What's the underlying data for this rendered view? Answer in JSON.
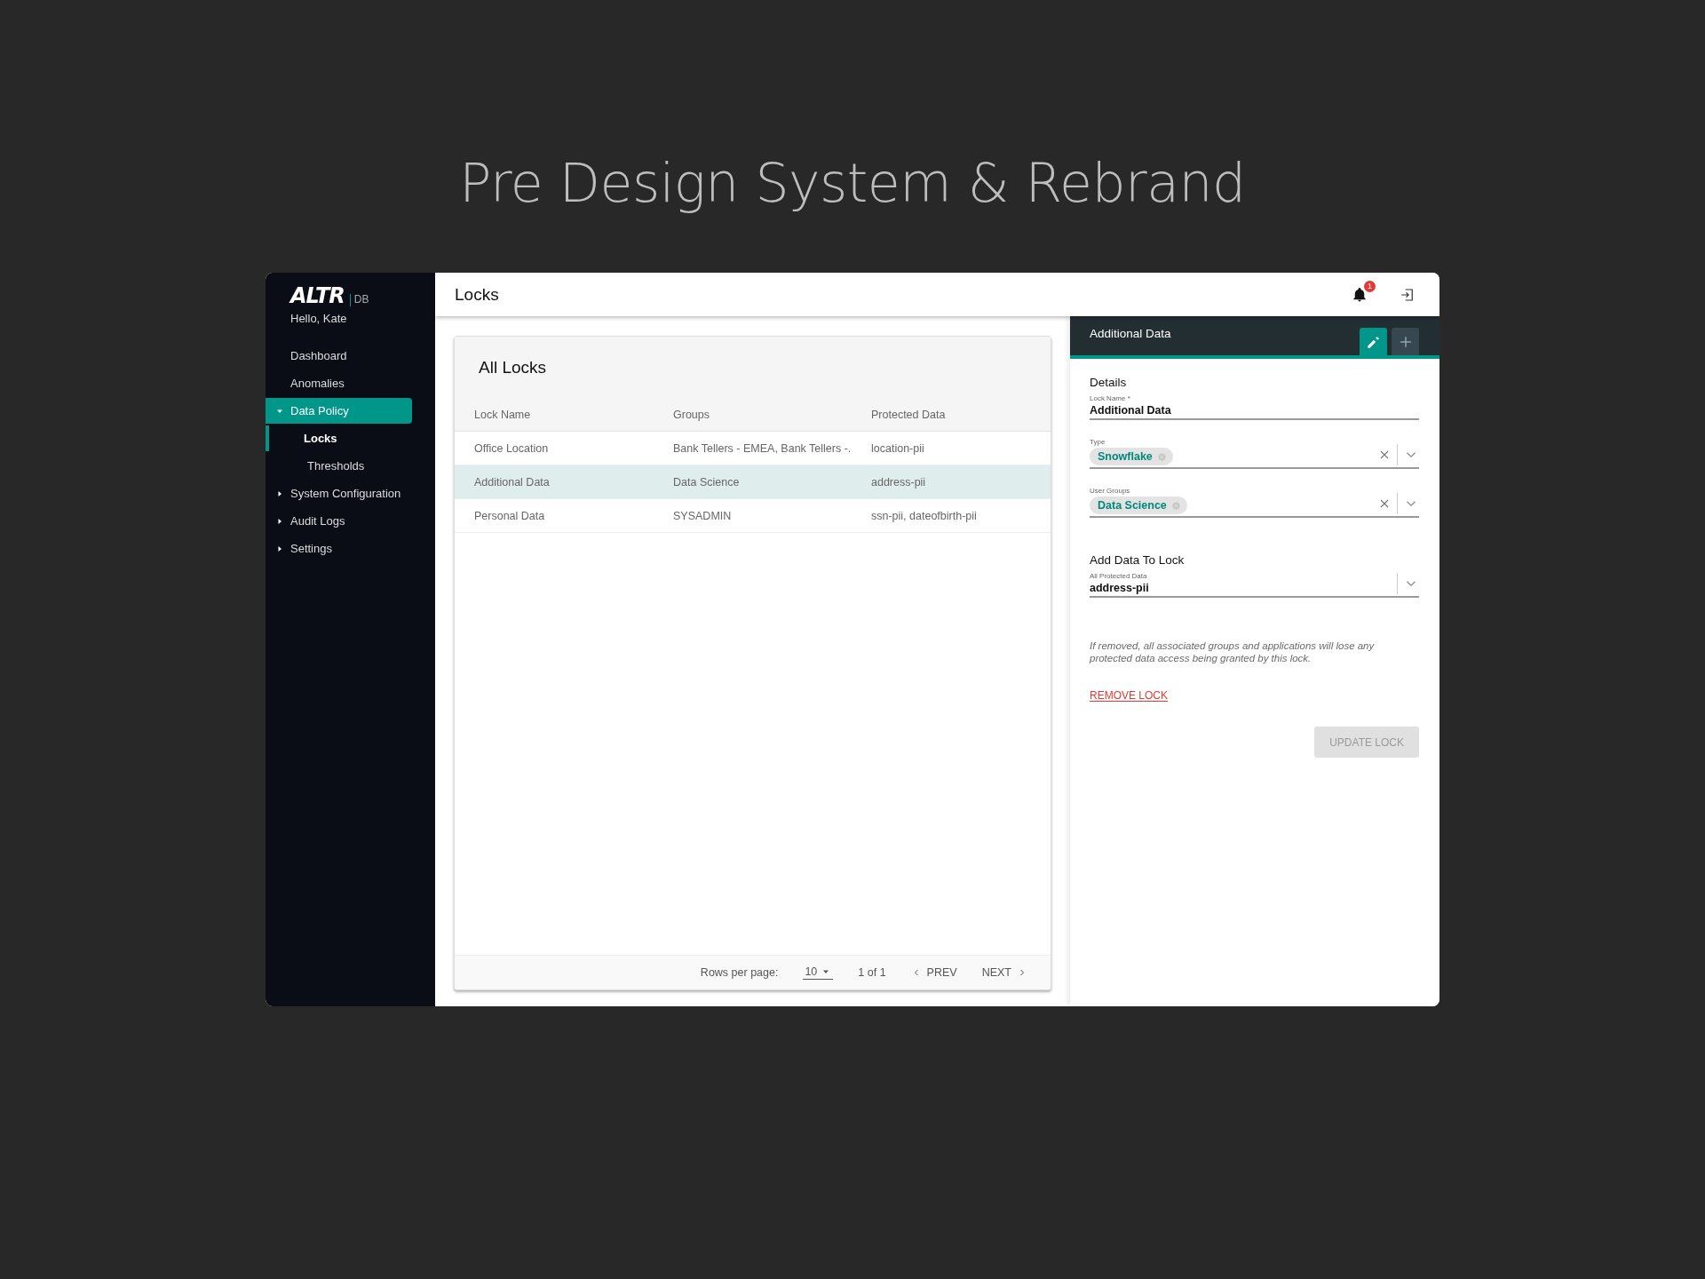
{
  "slide_title": "Pre Design System & Rebrand",
  "sidebar": {
    "logo": "ALTR",
    "logo_suffix": "DB",
    "greeting": "Hello, Kate",
    "items": [
      {
        "label": "Dashboard",
        "kind": "link",
        "selected": false
      },
      {
        "label": "Anomalies",
        "kind": "link",
        "selected": false
      },
      {
        "label": "Data Policy",
        "kind": "group",
        "expanded": true,
        "selected": true,
        "children": [
          {
            "label": "Locks",
            "selected": true
          },
          {
            "label": "Thresholds",
            "selected": false
          }
        ]
      },
      {
        "label": "System Configuration",
        "kind": "group",
        "expanded": false,
        "selected": false
      },
      {
        "label": "Audit Logs",
        "kind": "group",
        "expanded": false,
        "selected": false
      },
      {
        "label": "Settings",
        "kind": "group",
        "expanded": false,
        "selected": false
      }
    ]
  },
  "topbar": {
    "title": "Locks",
    "notification_count": "1"
  },
  "locks_card": {
    "title": "All Locks",
    "columns": [
      "Lock Name",
      "Groups",
      "Protected Data"
    ],
    "rows": [
      {
        "cells": [
          "Office Location",
          "Bank Tellers - EMEA, Bank Tellers -.",
          "location-pii"
        ],
        "selected": false
      },
      {
        "cells": [
          "Additional Data",
          "Data Science",
          "address-pii"
        ],
        "selected": true
      },
      {
        "cells": [
          "Personal Data",
          "SYSADMIN",
          "ssn-pii, dateofbirth-pii"
        ],
        "selected": false
      }
    ],
    "pagination": {
      "rows_per_page_label": "Rows per page:",
      "rows_per_page": "10",
      "page_info": "1 of 1",
      "prev": "PREV",
      "next": "NEXT"
    }
  },
  "detail_panel": {
    "title": "Additional Data",
    "tools": [
      {
        "kind": "edit",
        "selected": true
      },
      {
        "kind": "add",
        "selected": false
      }
    ],
    "sections": [
      {
        "heading": "Details",
        "fields": [
          {
            "kind": "text",
            "label": "Lock Name *",
            "value": "Additional Data"
          },
          {
            "kind": "chips",
            "label": "Type",
            "chips": [
              "Snowflake"
            ]
          },
          {
            "kind": "chips",
            "label": "User Groups",
            "chips": [
              "Data Science"
            ]
          }
        ]
      },
      {
        "heading": "Add Data To Lock",
        "fields": [
          {
            "kind": "select",
            "label": "All Protected Data",
            "value": "address-pii"
          }
        ]
      }
    ],
    "warning": "If removed, all associated groups and applications will lose any protected data access being granted by this lock.",
    "remove_link": "REMOVE LOCK",
    "update_button": {
      "label": "UPDATE LOCK",
      "disabled": true
    }
  }
}
